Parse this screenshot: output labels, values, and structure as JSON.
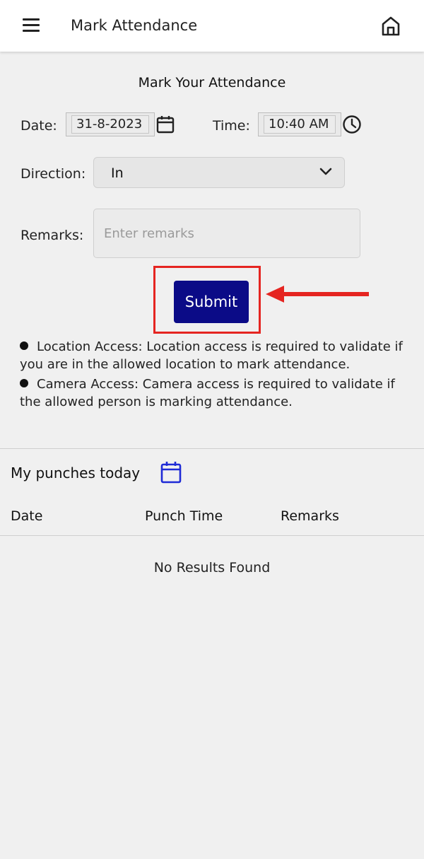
{
  "header": {
    "title": "Mark Attendance",
    "menu_icon": "menu-icon",
    "home_icon": "home-icon"
  },
  "form": {
    "heading": "Mark Your Attendance",
    "date_label": "Date:",
    "date_value": "31-8-2023",
    "time_label": "Time:",
    "time_value": "10:40 AM",
    "direction_label": "Direction:",
    "direction_value": "In",
    "remarks_label": "Remarks:",
    "remarks_placeholder": "Enter remarks",
    "remarks_value": "",
    "submit_label": "Submit"
  },
  "notes": [
    "Location Access: Location access is required to validate if you are in the allowed location to mark attendance.",
    "Camera Access: Camera access is required to validate if the allowed person is marking attendance."
  ],
  "punches": {
    "title": "My punches today",
    "columns": [
      "Date",
      "Punch Time",
      "Remarks"
    ],
    "empty_text": "No Results Found"
  },
  "colors": {
    "accent": "#0b0b87",
    "highlight": "#e52521",
    "calendar_blue": "#1f2bd6"
  }
}
